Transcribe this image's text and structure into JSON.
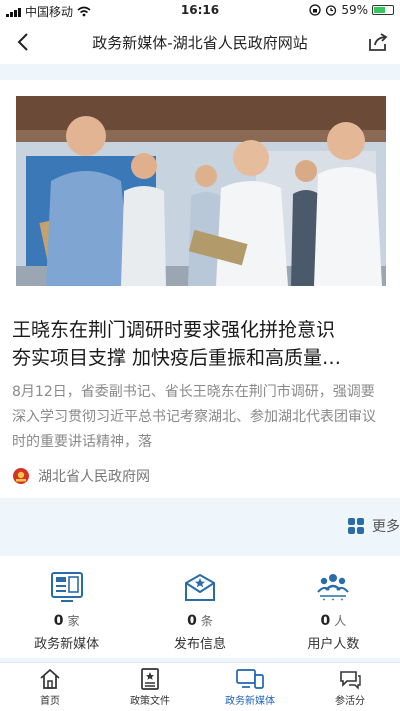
{
  "status_bar": {
    "carrier": "中国移动",
    "time": "16:16",
    "battery": "59%",
    "battery_level": 0.59
  },
  "nav": {
    "title": "政务新媒体-湖北省人民政府网站"
  },
  "article": {
    "headline_line1": "王晓东在荆门调研时要求强化拼抢意识",
    "headline_line2": "夯实项目支撑 加快疫后重振和高质量…",
    "summary": "8月12日，省委副书记、省长王晓东在荆门市调研，强调要深入学习贯彻习近平总书记考察湖北、参加湖北代表团审议时的重要讲话精神，落",
    "source": "湖北省人民政府网"
  },
  "more_label": "更多",
  "stats": [
    {
      "value": "0",
      "unit": "家",
      "label": "政务新媒体",
      "icon": "media-screen-icon"
    },
    {
      "value": "0",
      "unit": "条",
      "label": "发布信息",
      "icon": "envelope-star-icon"
    },
    {
      "value": "0",
      "unit": "人",
      "label": "用户人数",
      "icon": "users-group-icon"
    }
  ],
  "tabs": [
    {
      "label": "首页",
      "icon": "home-icon"
    },
    {
      "label": "政策文件",
      "icon": "document-star-icon"
    },
    {
      "label": "政务新媒体",
      "icon": "devices-icon"
    },
    {
      "label": "参活分",
      "icon": "interaction-icon"
    }
  ],
  "colors": {
    "accent": "#1f63b4",
    "icon_blue": "#2a6ca8",
    "page_bg": "#eef5fb"
  }
}
